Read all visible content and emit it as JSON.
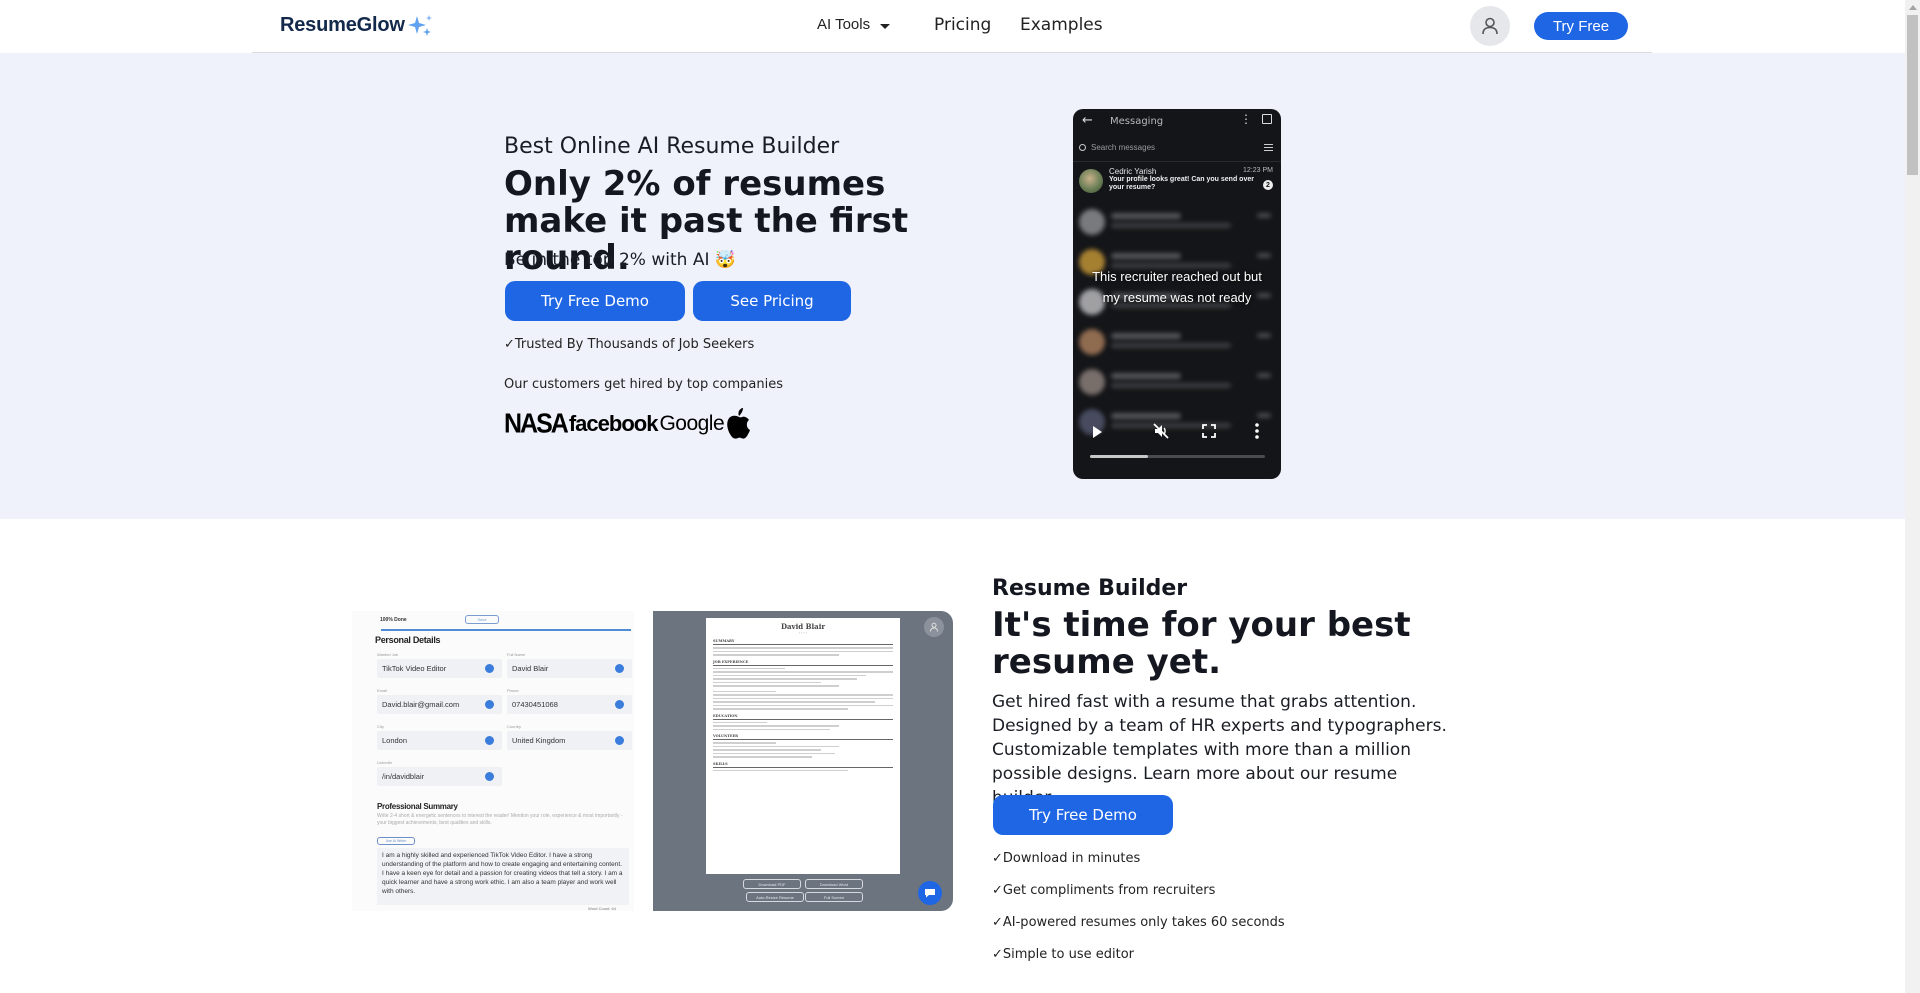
{
  "header": {
    "logo": "ResumeGlow",
    "nav": {
      "ai_tools": "AI Tools",
      "pricing": "Pricing",
      "examples": "Examples"
    },
    "try_free": "Try Free",
    "icons": {
      "logo_sparkle": "sparkle-icon",
      "dropdown": "caret-down-icon",
      "account": "user-icon"
    }
  },
  "hero": {
    "subtitle": "Best Online AI Resume Builder",
    "title": "Only 2% of resumes make it past the first round.",
    "tagline": "Be in the top 2% with AI 🤯",
    "primary_button": "Try Free Demo",
    "secondary_button": "See Pricing",
    "trusted": "✓Trusted By Thousands of Job Seekers",
    "customers_label": "Our customers get hired by top companies",
    "company_logos": [
      "NASA",
      "facebook",
      "Google",
      "Apple"
    ]
  },
  "video": {
    "app_title": "Messaging",
    "search_placeholder": "Search messages",
    "message": {
      "sender": "Cedric Yarish",
      "time": "12:23 PM",
      "text": "Your profile looks great! Can you send over your resume?",
      "unread_count": "2"
    },
    "caption": "This recruiter reached out but my resume was not ready",
    "progress_fraction": 0.33,
    "controls": [
      "play-icon",
      "mute-icon",
      "fullscreen-icon",
      "more-icon"
    ]
  },
  "builder_preview": {
    "progress_label": "100% Done",
    "save_label": "Save",
    "personal_heading": "Personal Details",
    "fields": [
      {
        "label": "Wanted Job",
        "value": "TikTok Video Editor"
      },
      {
        "label": "Full Name",
        "value": "David Blair"
      },
      {
        "label": "Email",
        "value": "David.blair@gmail.com"
      },
      {
        "label": "Phone",
        "value": "07430451068"
      },
      {
        "label": "City",
        "value": "London"
      },
      {
        "label": "Country",
        "value": "United Kingdom"
      },
      {
        "label": "LinkedIn",
        "value": "/in/davidblair"
      }
    ],
    "summary_heading": "Professional Summary",
    "summary_hint": "Write 2-4 short & energetic sentences to interest the reader! Mention your role, experience & most importantly - your biggest achievements, best qualities and skills.",
    "ai_button": "Use AI Writer",
    "summary_text": "I am a highly skilled and experienced TikTok Video Editor. I have a strong understanding of the platform and how to create engaging and entertaining content. I have a keen eye for detail and a passion for creating videos that tell a story. I am a quick learner and have a strong work ethic. I am also a team player and work well with others.",
    "word_count": "Word Count: 64"
  },
  "resume_preview": {
    "name": "David Blair",
    "sections": [
      "SUMMARY",
      "JOB EXPERIENCE",
      "EDUCATION",
      "VOLUNTEER",
      "SKILLS"
    ],
    "buttons": [
      "Download PDF",
      "Download Word",
      "Auto-Resize Resume",
      "Full Screen"
    ]
  },
  "resume_builder": {
    "label": "Resume Builder",
    "title": "It's time for your best resume yet.",
    "description": "Get hired fast with a resume that grabs attention. Designed by a team of HR experts and typographers. Customizable templates with more than a million possible designs. Learn more about our resume builder.",
    "button": "Try Free Demo",
    "features": [
      "✓Download in minutes",
      "✓Get compliments from recruiters",
      "✓AI-powered resumes only takes 60 seconds",
      "✓Simple to use editor"
    ]
  },
  "colors": {
    "brand_blue": "#1f66e5",
    "hero_bg": "#eff2fa",
    "logo_text": "#13294b",
    "sparkle": "#5fa0f0"
  }
}
